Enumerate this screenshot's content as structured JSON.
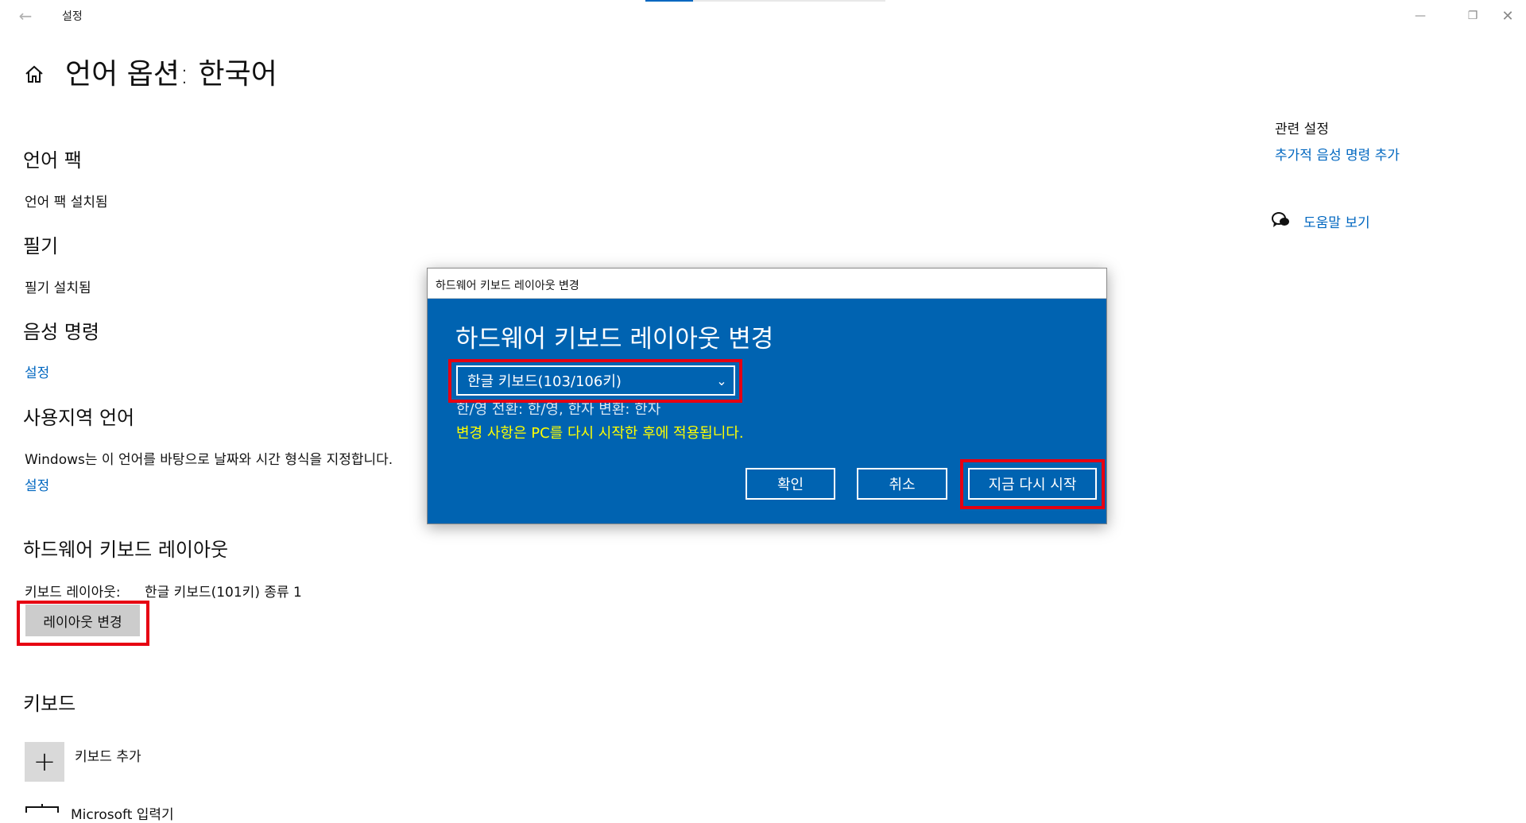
{
  "window": {
    "title": "설정",
    "page_title": "언어 옵션: 한국어",
    "loading_progress": 0.2
  },
  "sections": {
    "language_pack": {
      "heading": "언어 팩",
      "status": "언어 팩 설치됨"
    },
    "handwriting": {
      "heading": "필기",
      "status": "필기 설치됨"
    },
    "speech": {
      "heading": "음성 명령",
      "link": "설정"
    },
    "regional": {
      "heading": "사용지역 언어",
      "description": "Windows는 이 언어를 바탕으로 날짜와 시간 형식을 지정합니다.",
      "link": "설정"
    },
    "hardware_layout": {
      "heading": "하드웨어 키보드 레이아웃",
      "label": "키보드 레이아웃:",
      "value": "한글 키보드(101키) 종류 1",
      "button": "레이아웃 변경"
    },
    "keyboards": {
      "heading": "키보드",
      "add_label": "키보드 추가",
      "installed": "Microsoft 입력기"
    }
  },
  "related": {
    "heading": "관련 설정",
    "link": "추가적 음성 명령 추가",
    "help_link": "도움말 보기"
  },
  "dialog": {
    "caption": "하드웨어 키보드 레이아웃 변경",
    "heading": "하드웨어 키보드 레이아웃 변경",
    "selected_layout": "한글 키보드(103/106키)",
    "toggle_info": "한/영 전환: 한/영, 한자 변환: 한자",
    "restart_note": "변경 사항은 PC를 다시 시작한 후에 적용됩니다.",
    "ok_label": "확인",
    "cancel_label": "취소",
    "restart_label": "지금 다시 시작"
  },
  "colors": {
    "accent": "#0067c0",
    "dialog_bg": "#0063b1",
    "warning_text": "#ffff00",
    "highlight_box": "#e60012"
  },
  "icons": [
    "back-arrow-icon",
    "minimize-icon",
    "maximize-icon",
    "close-icon",
    "home-icon",
    "help-chat-icon",
    "plus-icon",
    "keyboard-icon",
    "chevron-down-icon"
  ]
}
